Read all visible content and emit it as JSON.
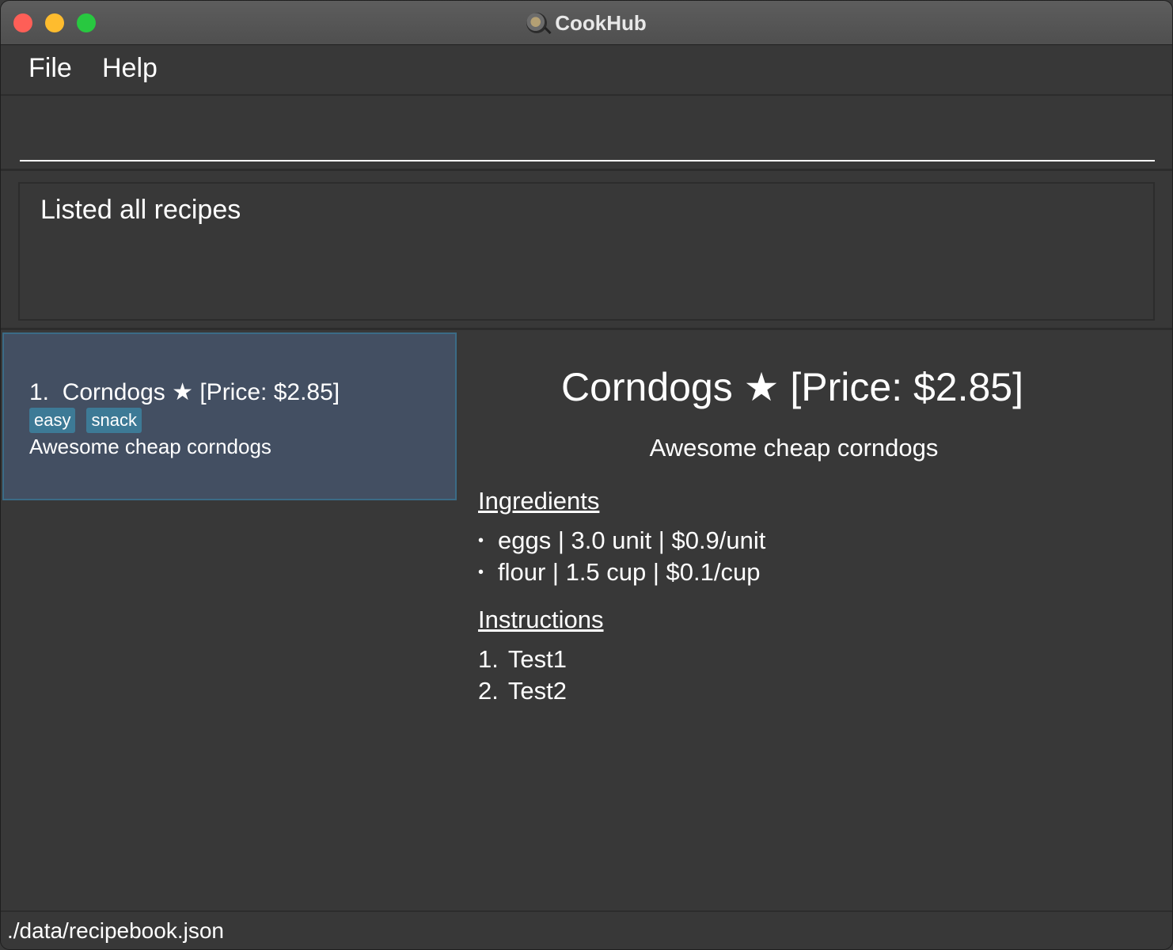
{
  "window": {
    "title": "CookHub",
    "app_icon": "cookhub-magnifier-icon"
  },
  "menu": {
    "file": "File",
    "help": "Help"
  },
  "command": {
    "value": "",
    "placeholder": ""
  },
  "result": {
    "message": "Listed all recipes"
  },
  "recipe_list": [
    {
      "index": "1.",
      "title": "Corndogs ★ [Price: $2.85]",
      "tags": [
        "easy",
        "snack"
      ],
      "description": "Awesome cheap corndogs",
      "selected": true
    }
  ],
  "detail": {
    "title": "Corndogs ★ [Price: $2.85]",
    "description": "Awesome cheap corndogs",
    "ingredients_heading": "Ingredients",
    "ingredients": [
      "eggs | 3.0 unit | $0.9/unit",
      "flour | 1.5 cup | $0.1/cup"
    ],
    "instructions_heading": "Instructions",
    "instructions": [
      {
        "num": "1.",
        "text": "Test1"
      },
      {
        "num": "2.",
        "text": "Test2"
      }
    ]
  },
  "status": {
    "path": "./data/recipebook.json"
  },
  "colors": {
    "background": "#383838",
    "selected_card": "#434f62",
    "selected_border": "#3b6b86",
    "tag": "#3d7a96",
    "close": "#fe5f57",
    "minimize": "#febc2e",
    "maximize": "#28c840"
  }
}
